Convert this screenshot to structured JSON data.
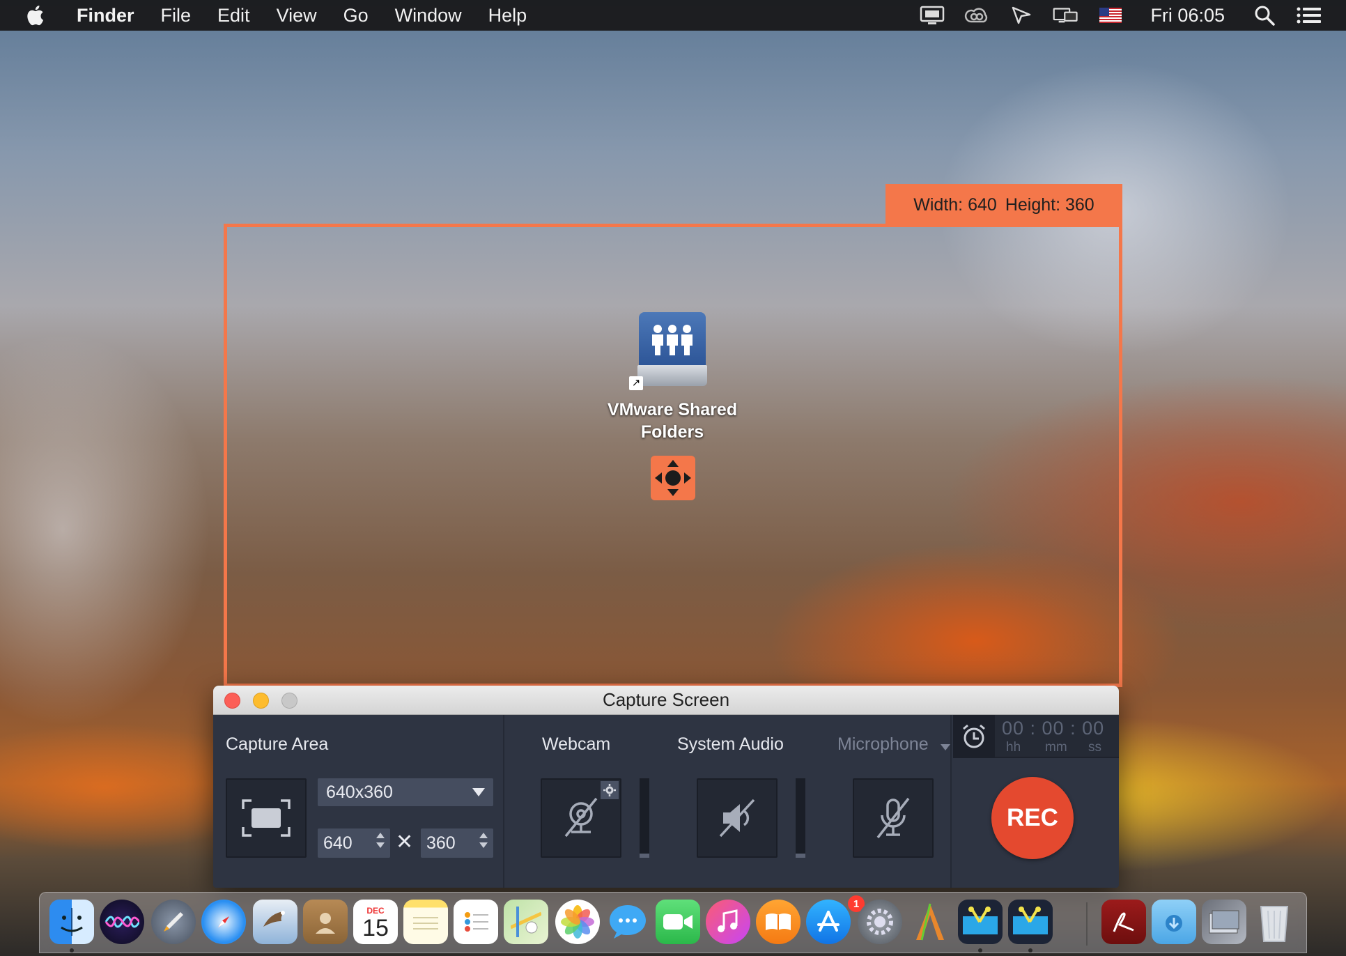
{
  "menubar": {
    "app_name": "Finder",
    "items": [
      "File",
      "Edit",
      "View",
      "Go",
      "Window",
      "Help"
    ],
    "clock": "Fri 06:05",
    "status_icons": [
      "display-mirror-icon",
      "creative-cloud-icon",
      "stack-icon",
      "screen-share-icon",
      "us-flag-icon",
      "search-icon",
      "list-icon"
    ]
  },
  "capture_frame": {
    "width_label": "Width:",
    "width_value": "640",
    "height_label": "Height:",
    "height_value": "360",
    "accent_color": "#f4774a"
  },
  "desktop_icon": {
    "label_line1": "VMware Shared",
    "label_line2": "Folders",
    "icon": "shared-folder-drive-icon"
  },
  "capture_window": {
    "title": "Capture Screen",
    "capture_area": {
      "label": "Capture Area",
      "preset": "640x360",
      "width": "640",
      "height": "360",
      "times_symbol": "✕"
    },
    "sources": {
      "webcam_label": "Webcam",
      "system_audio_label": "System Audio",
      "microphone_label": "Microphone",
      "webcam_state": "off",
      "system_audio_state": "off",
      "microphone_state": "off"
    },
    "timer": {
      "digits": "00 : 00 : 00",
      "units": [
        "hh",
        "mm",
        "ss"
      ]
    },
    "rec_label": "REC",
    "rec_color": "#e4492f"
  },
  "dock": {
    "items": [
      {
        "name": "finder-icon",
        "running": true
      },
      {
        "name": "siri-icon",
        "running": false
      },
      {
        "name": "launchpad-icon",
        "running": false
      },
      {
        "name": "safari-icon",
        "running": false
      },
      {
        "name": "mail-icon",
        "running": false
      },
      {
        "name": "contacts-icon",
        "running": false
      },
      {
        "name": "calendar-icon",
        "running": false,
        "month": "DEC",
        "day": "15"
      },
      {
        "name": "notes-icon",
        "running": false
      },
      {
        "name": "reminders-icon",
        "running": false
      },
      {
        "name": "maps-icon",
        "running": false
      },
      {
        "name": "photos-icon",
        "running": false
      },
      {
        "name": "messages-icon",
        "running": false
      },
      {
        "name": "facetime-icon",
        "running": false
      },
      {
        "name": "itunes-icon",
        "running": false
      },
      {
        "name": "ibooks-icon",
        "running": false
      },
      {
        "name": "app-store-icon",
        "running": false,
        "badge": "1"
      },
      {
        "name": "system-preferences-icon",
        "running": false
      },
      {
        "name": "instruments-icon",
        "running": false
      },
      {
        "name": "video-editor-icon",
        "running": true
      },
      {
        "name": "video-editor-2-icon",
        "running": true
      },
      {
        "name": "pdf-reader-icon",
        "running": false
      },
      {
        "name": "downloads-folder-icon",
        "running": false
      },
      {
        "name": "screenshots-stack-icon",
        "running": false
      },
      {
        "name": "trash-icon",
        "running": false
      }
    ]
  }
}
